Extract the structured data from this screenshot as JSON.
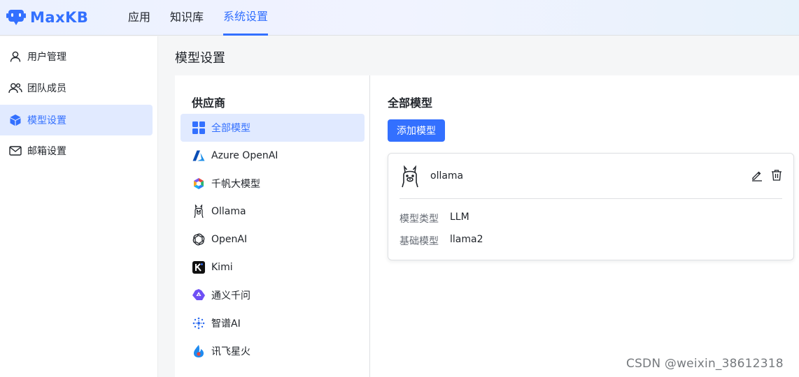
{
  "app": {
    "logo_text": "MaxKB"
  },
  "topnav": [
    {
      "label": "应用"
    },
    {
      "label": "知识库"
    },
    {
      "label": "系统设置",
      "active": true
    }
  ],
  "sidebar": {
    "items": [
      {
        "label": "用户管理",
        "icon": "user-icon"
      },
      {
        "label": "团队成员",
        "icon": "team-icon"
      },
      {
        "label": "模型设置",
        "icon": "cube-icon",
        "active": true
      },
      {
        "label": "邮箱设置",
        "icon": "mail-icon"
      }
    ]
  },
  "page": {
    "title": "模型设置"
  },
  "providers": {
    "heading": "供应商",
    "items": [
      {
        "label": "全部模型",
        "icon": "grid-icon",
        "active": true
      },
      {
        "label": "Azure OpenAI",
        "icon": "azure-icon"
      },
      {
        "label": "千帆大模型",
        "icon": "qianfan-icon"
      },
      {
        "label": "Ollama",
        "icon": "llama-icon"
      },
      {
        "label": "OpenAI",
        "icon": "openai-icon"
      },
      {
        "label": "Kimi",
        "icon": "kimi-icon"
      },
      {
        "label": "通义千问",
        "icon": "tongyi-icon"
      },
      {
        "label": "智谱AI",
        "icon": "zhipu-icon"
      },
      {
        "label": "讯飞星火",
        "icon": "xunfei-icon"
      }
    ]
  },
  "models": {
    "heading": "全部模型",
    "add_button": "添加模型",
    "cards": [
      {
        "name": "ollama",
        "icon": "llama-icon",
        "fields": [
          {
            "key": "模型类型",
            "value": "LLM"
          },
          {
            "key": "基础模型",
            "value": "llama2"
          }
        ]
      }
    ]
  },
  "watermark": "CSDN @weixin_38612318",
  "colors": {
    "accent": "#3370ff",
    "active_bg": "#e1eaff",
    "text": "#1f2329",
    "muted": "#646a73"
  }
}
